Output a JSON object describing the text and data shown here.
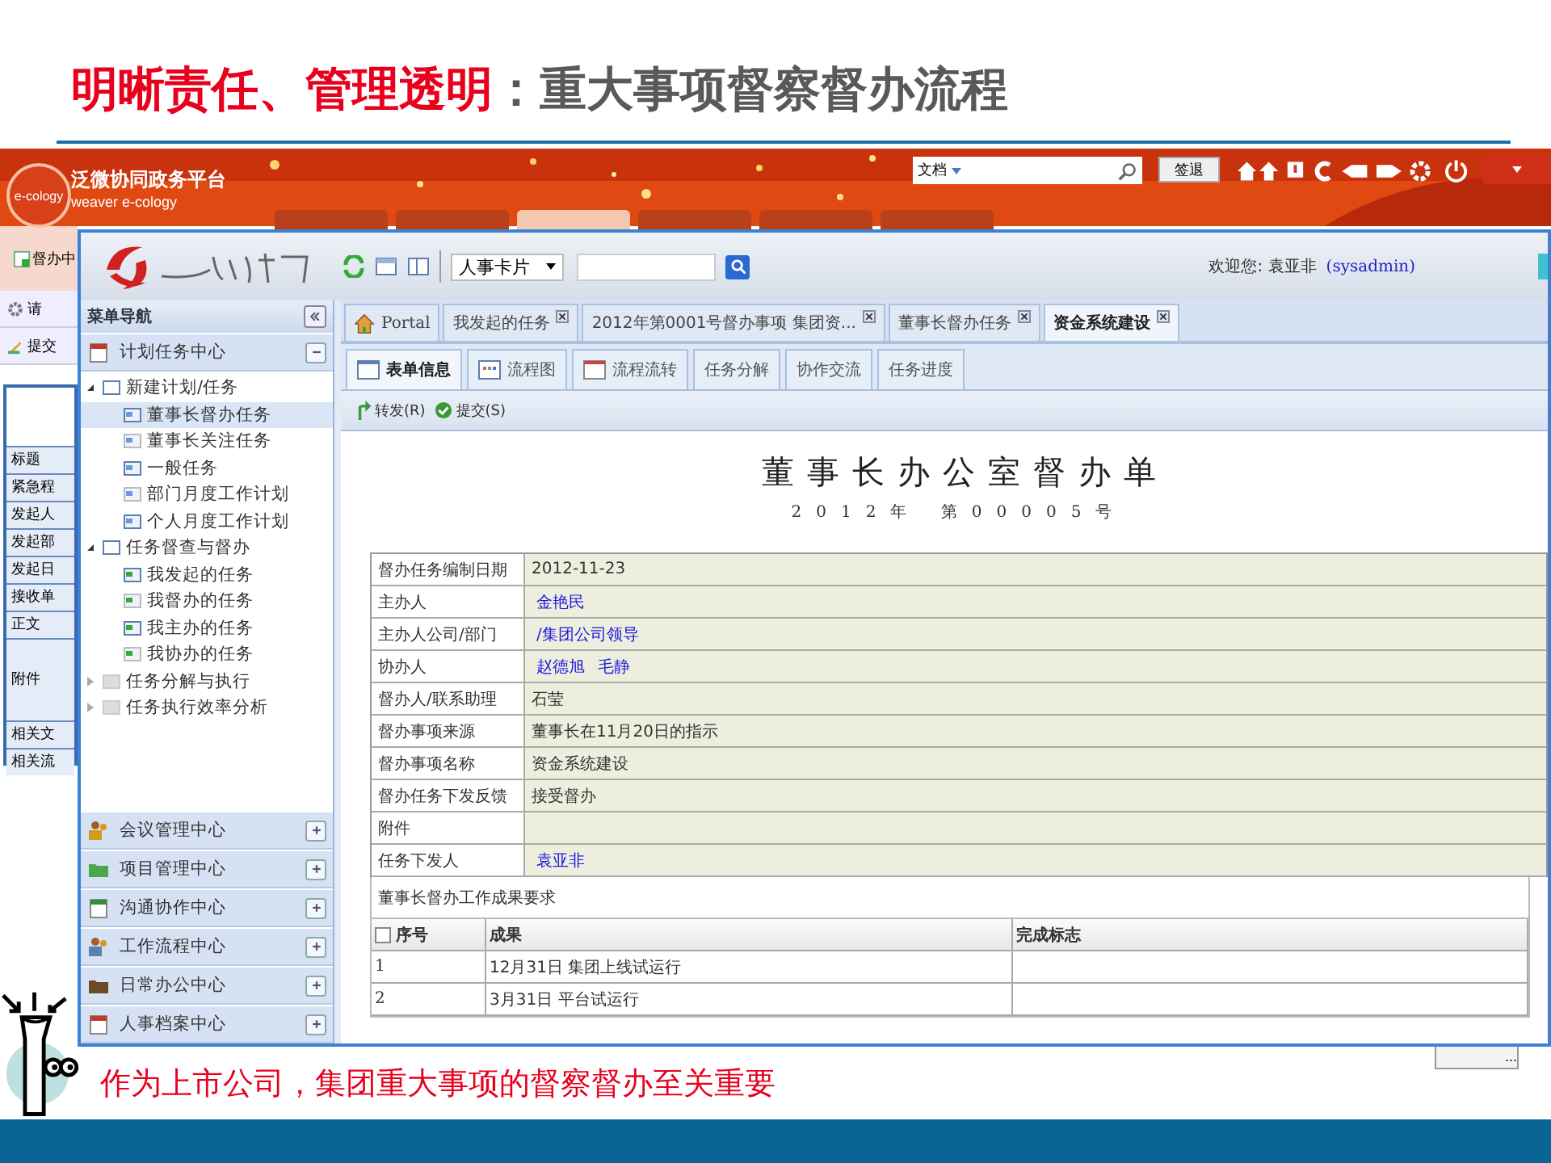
{
  "slide": {
    "title_lead": "明晰责任、管理透明",
    "title_rest": "：重大事项督察督办流程",
    "caption": "作为上市公司，集团重大事项的督察督办至关重要"
  },
  "back_window": {
    "logo_text": "e-cology",
    "brand": "泛微协同政务平台",
    "brand_sub": "weaver e-cology",
    "search": {
      "value": "文档"
    },
    "signout_button": "签退",
    "menu_tabs": [
      {
        "selected": false
      },
      {
        "selected": false
      },
      {
        "selected": true
      },
      {
        "selected": false
      },
      {
        "selected": false
      },
      {
        "selected": false
      }
    ],
    "strip_title": "督办中",
    "strip_request": "请",
    "strip_submit": "提交",
    "strip_labels": [
      "标题",
      "紧急程",
      "发起人",
      "发起部",
      "发起日",
      "接收单",
      "正文",
      "附件",
      "相关文",
      "相关流"
    ],
    "more_button": "..."
  },
  "front_window": {
    "card_select": {
      "value": "人事卡片"
    },
    "welcome": "欢迎您: 袁亚非",
    "user": "(sysadmin)",
    "sidebar": {
      "title": "菜单导航",
      "modules": [
        {
          "label": "计划任务中心",
          "expanded": true
        },
        {
          "label": "会议管理中心",
          "expanded": false
        },
        {
          "label": "项目管理中心",
          "expanded": false
        },
        {
          "label": "沟通协作中心",
          "expanded": false
        },
        {
          "label": "工作流程中心",
          "expanded": false
        },
        {
          "label": "日常办公中心",
          "expanded": false
        },
        {
          "label": "人事档案中心",
          "expanded": false
        }
      ],
      "tree": [
        {
          "label": "新建计划/任务",
          "expanded": true,
          "selected": false,
          "children": [
            {
              "label": "董事长督办任务",
              "selected": true
            },
            {
              "label": "董事长关注任务",
              "selected": false
            },
            {
              "label": "一般任务",
              "selected": false
            },
            {
              "label": "部门月度工作计划",
              "selected": false
            },
            {
              "label": "个人月度工作计划",
              "selected": false
            }
          ]
        },
        {
          "label": "任务督查与督办",
          "expanded": true,
          "selected": false,
          "children": [
            {
              "label": "我发起的任务",
              "selected": false
            },
            {
              "label": "我督办的任务",
              "selected": false
            },
            {
              "label": "我主办的任务",
              "selected": false
            },
            {
              "label": "我协办的任务",
              "selected": false
            }
          ]
        },
        {
          "label": "任务分解与执行",
          "expanded": false,
          "selected": false
        },
        {
          "label": "任务执行效率分析",
          "expanded": false,
          "selected": false
        }
      ]
    },
    "tabs": [
      {
        "label": "Portal",
        "kind": "home",
        "selected": false
      },
      {
        "label": "我发起的任务",
        "kind": "page",
        "selected": false
      },
      {
        "label": "2012年第0001号督办事项 集团资...",
        "kind": "page",
        "selected": false
      },
      {
        "label": "董事长督办任务",
        "kind": "page",
        "selected": false
      },
      {
        "label": "资金系统建设",
        "kind": "page",
        "selected": true
      }
    ],
    "subtabs": [
      {
        "label": "表单信息",
        "kind": "form",
        "selected": true
      },
      {
        "label": "流程图",
        "kind": "chart",
        "selected": false
      },
      {
        "label": "流程流转",
        "kind": "window",
        "selected": false
      },
      {
        "label": "任务分解",
        "kind": "plain",
        "selected": false
      },
      {
        "label": "协作交流",
        "kind": "plain",
        "selected": false
      },
      {
        "label": "任务进度",
        "kind": "plain",
        "selected": false
      }
    ],
    "actions": [
      {
        "label": "转发(R)",
        "kind": "forward"
      },
      {
        "label": "提交(S)",
        "kind": "submit"
      }
    ],
    "form": {
      "title": "董事长办公室督办单",
      "subtitle": "2012年 第00005号",
      "fields": [
        {
          "label": "督办任务编制日期",
          "values": [
            "2012-11-23"
          ],
          "link": false
        },
        {
          "label": "主办人",
          "values": [
            "金艳民"
          ],
          "link": true
        },
        {
          "label": "主办人公司/部门",
          "values": [
            "/集团公司领导"
          ],
          "link": true
        },
        {
          "label": "协办人",
          "values": [
            "赵德旭",
            "毛静"
          ],
          "link": true
        },
        {
          "label": "督办人/联系助理",
          "values": [
            "石莹"
          ],
          "link": false
        },
        {
          "label": "督办事项来源",
          "values": [
            "董事长在11月20日的指示"
          ],
          "link": false
        },
        {
          "label": "督办事项名称",
          "values": [
            "资金系统建设"
          ],
          "link": false
        },
        {
          "label": "督办任务下发反馈",
          "values": [
            "接受督办"
          ],
          "link": false
        },
        {
          "label": "附件"
        },
        {
          "label": "任务下发人",
          "values": [
            "袁亚非"
          ],
          "link": true
        }
      ],
      "results": {
        "title": "董事长督办工作成果要求",
        "select_all": {
          "checked": false
        },
        "columns": [
          "序号",
          "成果",
          "完成标志"
        ],
        "rows": [
          {
            "no": "1",
            "result": "12月31日 集团上线试运行"
          },
          {
            "no": "2",
            "result": "3月31日 平台试运行"
          }
        ]
      }
    }
  }
}
